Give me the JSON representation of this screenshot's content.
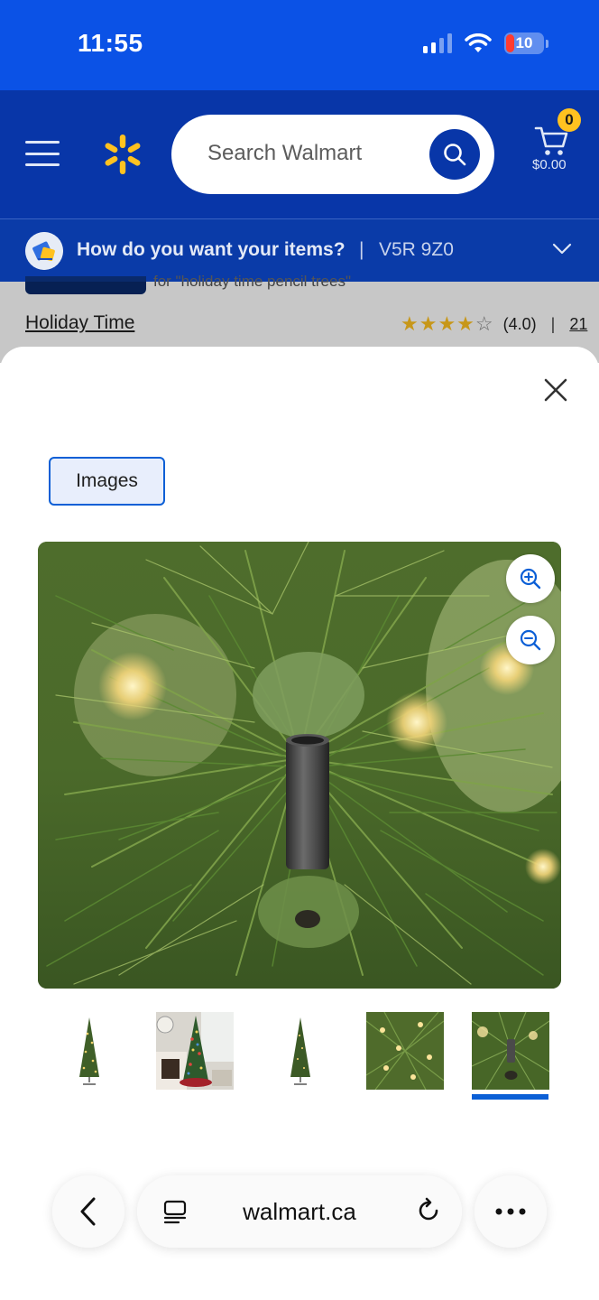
{
  "status_bar": {
    "time": "11:55",
    "battery_level": "10",
    "background_color": "#0b52e6"
  },
  "header": {
    "background_color": "#0836a8",
    "logo_icon": "walmart-spark-icon",
    "logo_color": "#ffc220",
    "search_placeholder": "Search Walmart",
    "cart_count": "0",
    "cart_total": "$0.00"
  },
  "delivery": {
    "question": "How do you want your items?",
    "separator": "|",
    "postal_code": "V5R 9Z0"
  },
  "product": {
    "subtext": "for \"holiday time pencil trees\"",
    "brand": "Holiday Time",
    "rating_value": "(4.0)",
    "rating_separator": "|",
    "review_count": "21",
    "stars_filled": 4,
    "stars_total": 5
  },
  "modal": {
    "close_icon": "close-icon",
    "tab_label": "Images",
    "zoom_in_icon": "zoom-in-icon",
    "zoom_out_icon": "zoom-out-icon",
    "main_image": "Close-up of tree pole socket among pine needles with warm lights",
    "thumbnails": [
      {
        "label": "Pencil tree full view",
        "selected": false
      },
      {
        "label": "Tree in living room scene",
        "selected": false
      },
      {
        "label": "Pencil tree unlit view",
        "selected": false
      },
      {
        "label": "Lit branches close-up",
        "selected": false
      },
      {
        "label": "Pole socket close-up",
        "selected": true
      }
    ],
    "accent_color": "#0b5fd6"
  },
  "browser": {
    "domain": "walmart.ca",
    "back_icon": "chevron-left-icon",
    "tabs_icon": "tabs-icon",
    "reload_icon": "reload-icon",
    "more_icon": "more-icon"
  }
}
